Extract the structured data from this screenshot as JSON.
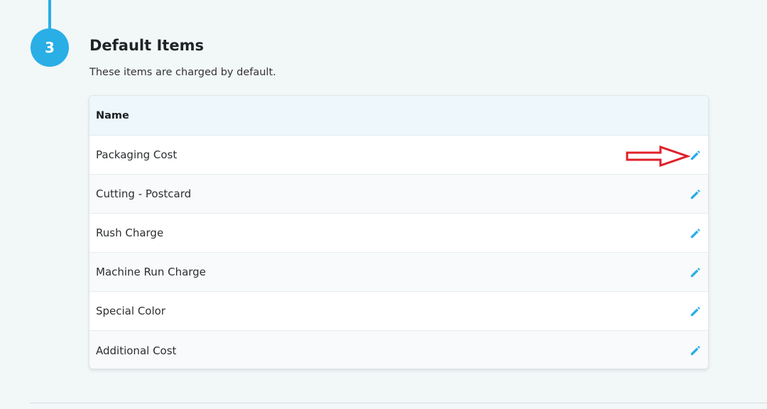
{
  "step": {
    "number": "3"
  },
  "section": {
    "title": "Default Items",
    "subtitle": "These items are charged by default."
  },
  "table": {
    "header": {
      "name": "Name"
    },
    "rows": [
      {
        "name": "Packaging Cost",
        "action_icon": "pencil-icon"
      },
      {
        "name": "Cutting - Postcard",
        "action_icon": "pencil-icon"
      },
      {
        "name": "Rush Charge",
        "action_icon": "pencil-icon"
      },
      {
        "name": "Machine Run Charge",
        "action_icon": "pencil-icon"
      },
      {
        "name": "Special Color",
        "action_icon": "pencil-icon"
      },
      {
        "name": "Additional Cost",
        "action_icon": "pencil-icon"
      }
    ]
  },
  "colors": {
    "accent": "#29aee6",
    "annotation": "#e0202a",
    "background": "#f2f7f8"
  }
}
